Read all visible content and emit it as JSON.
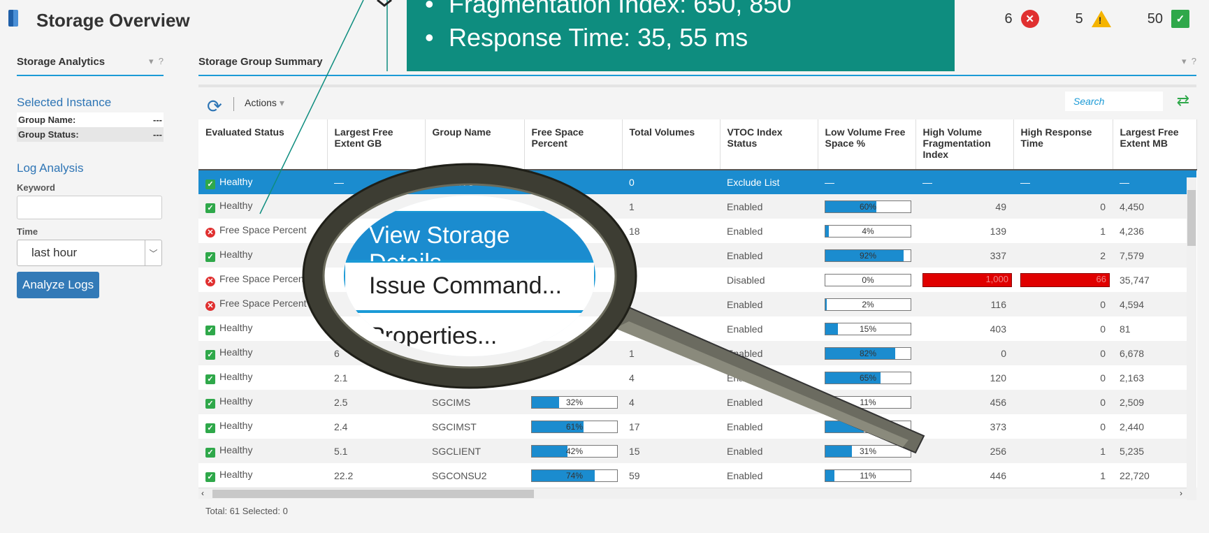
{
  "header": {
    "title": "Storage Overview",
    "counts": {
      "error": "6",
      "warning": "5",
      "ok": "50"
    }
  },
  "callout": {
    "line1": "Fragmentation Index: 650, 850",
    "line2": "Response Time: 35, 55 ms"
  },
  "left_panel": {
    "title": "Storage Analytics",
    "selected_instance": {
      "title": "Selected Instance",
      "group_name_label": "Group Name:",
      "group_name_value": "---",
      "group_status_label": "Group Status:",
      "group_status_value": "---"
    },
    "log_analysis": {
      "title": "Log Analysis",
      "keyword_label": "Keyword",
      "keyword_value": "",
      "time_label": "Time",
      "time_value": "last hour",
      "analyze_button": "Analyze Logs"
    }
  },
  "main": {
    "title": "Storage Group Summary",
    "actions_label": "Actions",
    "search_placeholder": "Search",
    "columns": [
      "Evaluated Status",
      "Largest Free Extent GB",
      "Group Name",
      "Free Space Percent",
      "Total Volumes",
      "VTOC Index Status",
      "Low Volume Free Space %",
      "High Volume Fragmentation Index",
      "High Response Time",
      "Largest Free Extent MB"
    ],
    "rows": [
      {
        "status": "Healthy",
        "ok": true,
        "gb": "—",
        "group": "SCOMVS",
        "fsp": "",
        "fsp_val": null,
        "vol": "0",
        "vtoc": "Exclude List",
        "low": "—",
        "low_val": null,
        "frag": "—",
        "resp": "—",
        "mb": "—"
      },
      {
        "status": "Healthy",
        "ok": true,
        "gb": "",
        "group": "",
        "fsp": "",
        "fsp_val": null,
        "vol": "1",
        "vtoc": "Enabled",
        "low": "60%",
        "low_val": 60,
        "frag": "49",
        "resp": "0",
        "mb": "4,450"
      },
      {
        "status": "Free Space Percent",
        "ok": false,
        "gb": "",
        "group": "",
        "fsp": "",
        "fsp_val": null,
        "vol": "18",
        "vtoc": "Enabled",
        "low": "4%",
        "low_val": 4,
        "frag": "139",
        "resp": "1",
        "mb": "4,236"
      },
      {
        "status": "Healthy",
        "ok": true,
        "gb": "",
        "group": "",
        "fsp": "",
        "fsp_val": null,
        "vol": "",
        "vtoc": "Enabled",
        "low": "92%",
        "low_val": 92,
        "frag": "337",
        "resp": "2",
        "mb": "7,579"
      },
      {
        "status": "Free Space Percent",
        "ok": false,
        "gb": "",
        "group": "",
        "fsp": "",
        "fsp_val": null,
        "vol": "1",
        "vtoc": "Disabled",
        "low": "0%",
        "low_val": 0,
        "frag": "1,000",
        "resp": "66",
        "mb": "35,747",
        "flag": true
      },
      {
        "status": "Free Space Percent",
        "ok": false,
        "gb": "",
        "group": "",
        "fsp": "",
        "fsp_val": null,
        "vol": "",
        "vtoc": "Enabled",
        "low": "2%",
        "low_val": 2,
        "frag": "116",
        "resp": "0",
        "mb": "4,594"
      },
      {
        "status": "Healthy",
        "ok": true,
        "gb": "",
        "group": "",
        "fsp": "",
        "fsp_val": null,
        "vol": "",
        "vtoc": "Enabled",
        "low": "15%",
        "low_val": 15,
        "frag": "403",
        "resp": "0",
        "mb": "81"
      },
      {
        "status": "Healthy",
        "ok": true,
        "gb": "6",
        "group": "",
        "fsp": "",
        "fsp_val": null,
        "vol": "1",
        "vtoc": "Enabled",
        "low": "82%",
        "low_val": 82,
        "frag": "0",
        "resp": "0",
        "mb": "6,678"
      },
      {
        "status": "Healthy",
        "ok": true,
        "gb": "2.1",
        "group": "",
        "fsp": "",
        "fsp_val": null,
        "vol": "4",
        "vtoc": "Enabled",
        "low": "65%",
        "low_val": 65,
        "frag": "120",
        "resp": "0",
        "mb": "2,163"
      },
      {
        "status": "Healthy",
        "ok": true,
        "gb": "2.5",
        "group": "SGCIMS",
        "fsp": "32%",
        "fsp_val": 32,
        "vol": "4",
        "vtoc": "Enabled",
        "low": "11%",
        "low_val": 11,
        "frag": "456",
        "resp": "0",
        "mb": "2,509"
      },
      {
        "status": "Healthy",
        "ok": true,
        "gb": "2.4",
        "group": "SGCIMST",
        "fsp": "61%",
        "fsp_val": 61,
        "vol": "17",
        "vtoc": "Enabled",
        "low": "",
        "low_val": 45,
        "frag": "373",
        "resp": "0",
        "mb": "2,440"
      },
      {
        "status": "Healthy",
        "ok": true,
        "gb": "5.1",
        "group": "SGCLIENT",
        "fsp": "42%",
        "fsp_val": 42,
        "vol": "15",
        "vtoc": "Enabled",
        "low": "31%",
        "low_val": 31,
        "frag": "256",
        "resp": "1",
        "mb": "5,235"
      },
      {
        "status": "Healthy",
        "ok": true,
        "gb": "22.2",
        "group": "SGCONSU2",
        "fsp": "74%",
        "fsp_val": 74,
        "vol": "59",
        "vtoc": "Enabled",
        "low": "11%",
        "low_val": 11,
        "frag": "446",
        "resp": "1",
        "mb": "22,720"
      }
    ],
    "footer": "Total: 61 Selected: 0"
  },
  "context_menu": {
    "items": [
      "View Storage Details",
      "Issue Command...",
      "Properties..."
    ]
  }
}
